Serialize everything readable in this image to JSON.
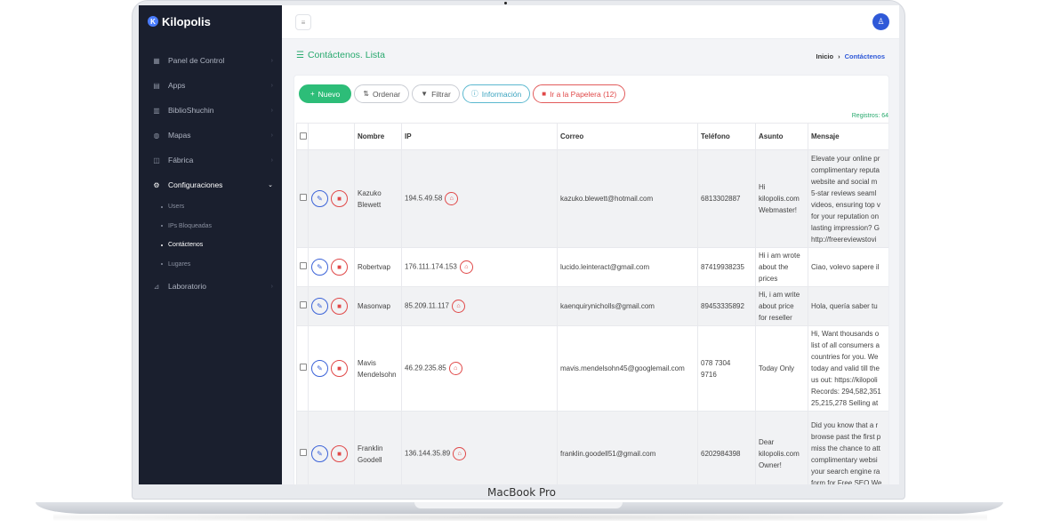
{
  "device_label": "MacBook Pro",
  "brand": {
    "logo_letter": "K",
    "name": "Kilopolis"
  },
  "sidebar": {
    "items": [
      {
        "icon": "▦",
        "label": "Panel de Control"
      },
      {
        "icon": "▤",
        "label": "Apps"
      },
      {
        "icon": "▥",
        "label": "BiblioShuchin"
      },
      {
        "icon": "◍",
        "label": "Mapas"
      },
      {
        "icon": "◫",
        "label": "Fábrica"
      },
      {
        "icon": "⚙",
        "label": "Configuraciones"
      },
      {
        "icon": "⊿",
        "label": "Laboratorio"
      }
    ],
    "sub_items": [
      "Users",
      "IPs Bloqueadas",
      "Contáctenos",
      "Lugares"
    ]
  },
  "topbar": {
    "menu_glyph": "≡",
    "user_glyph": "♙"
  },
  "page": {
    "title": "Contáctenos. Lista",
    "breadcrumb_home": "Inicio",
    "breadcrumb_current": "Contáctenos"
  },
  "toolbar": {
    "nuevo": "Nuevo",
    "ordenar": "Ordenar",
    "filtrar": "Filtrar",
    "informacion": "Información",
    "papelera": "Ir a la Papelera (12)"
  },
  "registros": "Registros: 64",
  "table": {
    "headers": {
      "nombre": "Nombre",
      "ip": "IP",
      "correo": "Correo",
      "telefono": "Teléfono",
      "asunto": "Asunto",
      "mensaje": "Mensaje"
    },
    "rows": [
      {
        "nombre_1": "Kazuko",
        "nombre_2": "Blewett",
        "ip": "194.5.49.58",
        "correo": "kazuko.blewett@hotmail.com",
        "telefono": "6813302887",
        "asunto_1": "Hi",
        "asunto_2": "kilopolis.com",
        "asunto_3": "Webmaster!",
        "msg": [
          "Elevate your online pr",
          "complimentary reputa",
          "website and social m",
          "5-star reviews seaml",
          "videos, ensuring top v",
          "for your reputation on",
          "lasting impression? G",
          "http://freereviewstovi"
        ]
      },
      {
        "nombre_1": "Robertvap",
        "nombre_2": "",
        "ip": "176.111.174.153",
        "correo": "lucido.leinteract@gmail.com",
        "telefono": "87419938235",
        "asunto_1": "Hi i am wrote",
        "asunto_2": "about the",
        "asunto_3": "prices",
        "msg": [
          "Ciao, volevo sapere il"
        ]
      },
      {
        "nombre_1": "Masonvap",
        "nombre_2": "",
        "ip": "85.209.11.117",
        "correo": "kaenquirynicholls@gmail.com",
        "telefono": "89453335892",
        "asunto_1": "Hi, i am write",
        "asunto_2": "about price",
        "asunto_3": "for reseller",
        "msg": [
          "Hola, quería saber tu"
        ]
      },
      {
        "nombre_1": "Mavis",
        "nombre_2": "Mendelsohn",
        "ip": "46.29.235.85",
        "correo": "mavis.mendelsohn45@googlemail.com",
        "telefono_1": "078 7304",
        "telefono_2": "9716",
        "asunto_1": "Today Only",
        "asunto_2": "",
        "asunto_3": "",
        "msg": [
          "Hi, Want thousands o",
          "list of all consumers a",
          "countries for you. We",
          "today and valid till the",
          "us out: https://kilopoli",
          "Records: 294,582,351",
          "25,215,278 Selling at"
        ]
      },
      {
        "nombre_1": "Franklin",
        "nombre_2": "Goodell",
        "ip": "136.144.35.89",
        "correo": "franklin.goodell51@gmail.com",
        "telefono": "6202984398",
        "asunto_1": "Dear",
        "asunto_2": "kilopolis.com",
        "asunto_3": "Owner!",
        "msg": [
          "Did you know that a r",
          "browse past the first p",
          "miss the chance to att",
          "complimentary websi",
          "your search engine ra",
          "form for Free SEO We"
        ]
      }
    ]
  }
}
